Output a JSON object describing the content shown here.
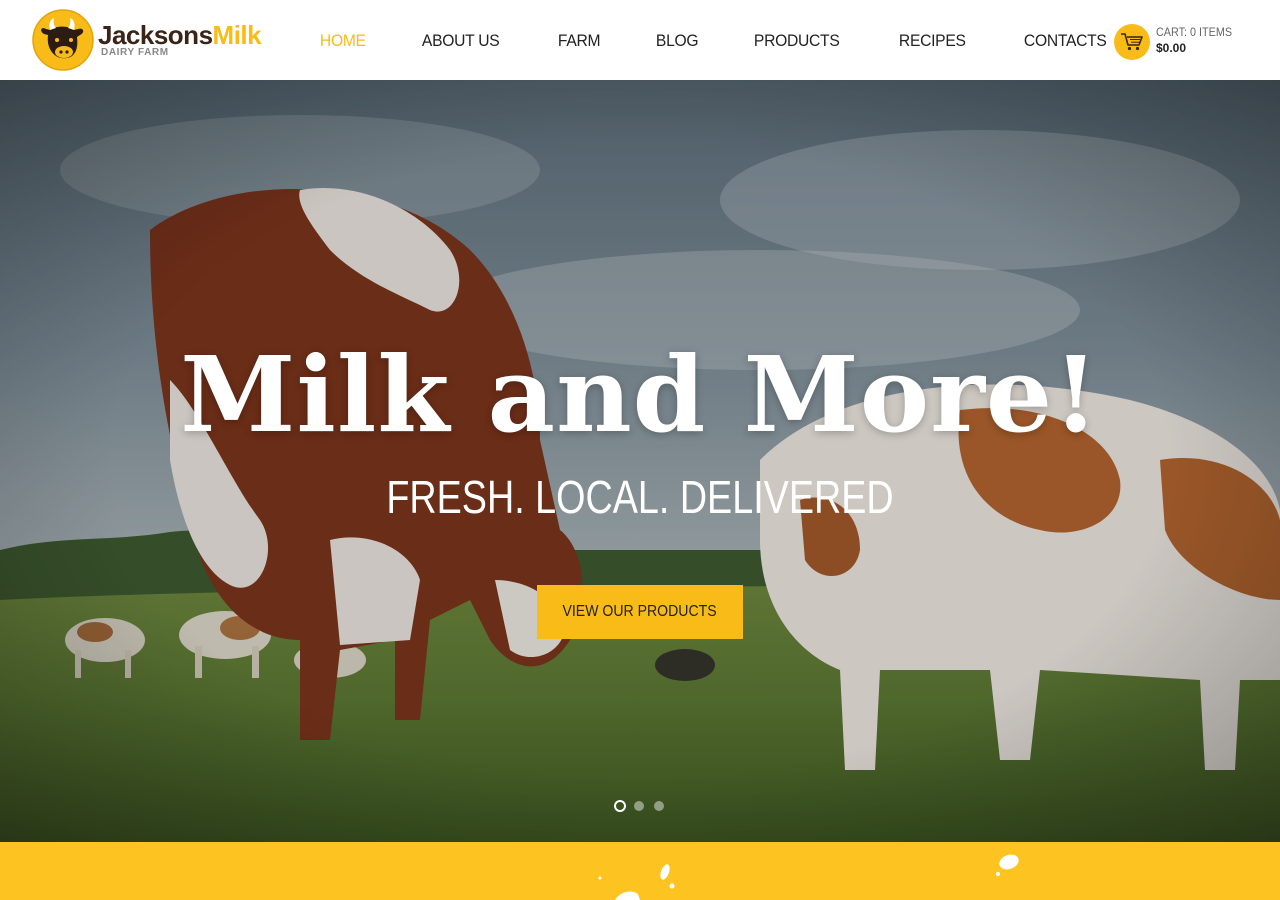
{
  "brand": {
    "name_part1": "Jacksons",
    "name_part2": "Milk",
    "tagline": "DAIRY FARM",
    "colors": {
      "accent": "#f9bb18",
      "dark": "#3a2418"
    }
  },
  "nav": {
    "items": [
      {
        "label": "HOME",
        "active": true
      },
      {
        "label": "ABOUT US",
        "active": false
      },
      {
        "label": "FARM",
        "active": false
      },
      {
        "label": "BLOG",
        "active": false
      },
      {
        "label": "PRODUCTS",
        "active": false
      },
      {
        "label": "RECIPES",
        "active": false
      },
      {
        "label": "CONTACTS",
        "active": false
      }
    ]
  },
  "cart": {
    "icon": "shopping-cart-icon",
    "label": "CART: 0 ITEMS",
    "total": "$0.00"
  },
  "hero": {
    "title": "Milk and More!",
    "subtitle": "FRESH. LOCAL. DELIVERED",
    "button_label": "VIEW OUR PRODUCTS",
    "slides_total": 3,
    "active_slide": 1
  },
  "band": {
    "color": "#fdc320"
  }
}
